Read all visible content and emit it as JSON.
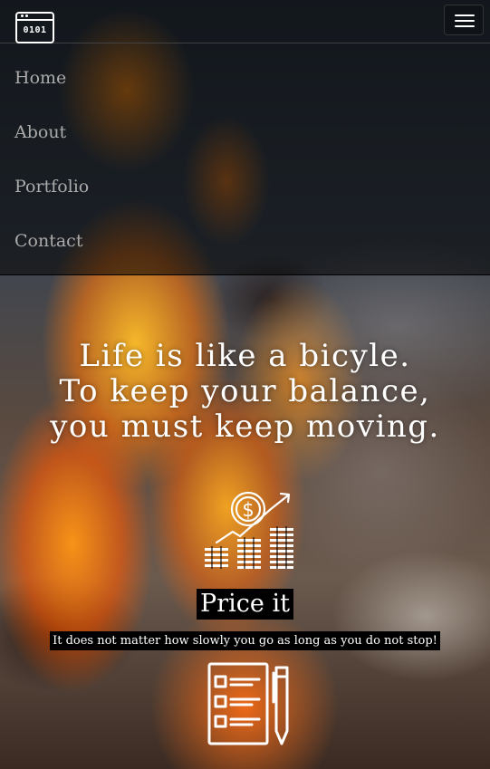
{
  "header": {
    "logo_text": "0101",
    "menu_toggle_label": "Toggle navigation"
  },
  "nav": {
    "items": [
      {
        "label": "Home"
      },
      {
        "label": "About"
      },
      {
        "label": "Portfolio"
      },
      {
        "label": "Contact"
      }
    ]
  },
  "hero": {
    "quote_lines": [
      "Life is like a bicyle.",
      "To keep your balance,",
      "you must keep moving."
    ],
    "background": "campfire-photo"
  },
  "feature": {
    "icon": "money-growth-icon",
    "title": "Price it",
    "text": "It does not matter how slowly you go as long as you do not stop!",
    "next_icon": "checklist-pen-icon"
  },
  "colors": {
    "nav_overlay": "#000000",
    "nav_text": "#aaaaaa",
    "text": "#ffffff",
    "label_background": "#000000"
  }
}
